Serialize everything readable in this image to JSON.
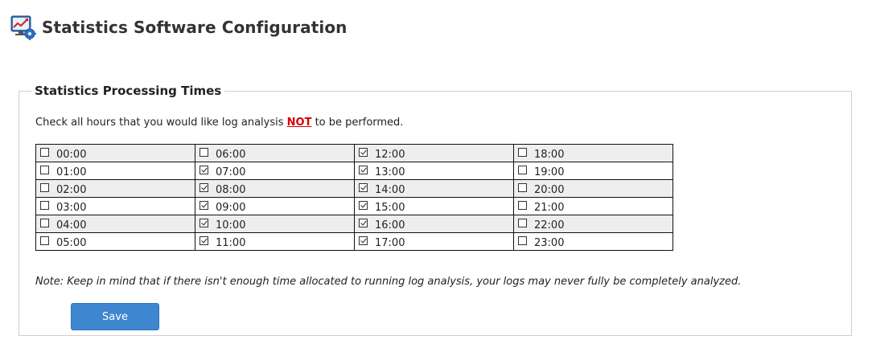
{
  "header": {
    "title": "Statistics Software Configuration",
    "icon": "statistics-monitor-gear-icon"
  },
  "section": {
    "legend": "Statistics Processing Times",
    "instruction_prefix": "Check all hours that you would like log analysis ",
    "instruction_emphasis": "NOT",
    "instruction_suffix": " to be performed.",
    "emphasis_color": "#d40000"
  },
  "hours": [
    [
      {
        "label": "00:00",
        "checked": false
      },
      {
        "label": "06:00",
        "checked": false
      },
      {
        "label": "12:00",
        "checked": true
      },
      {
        "label": "18:00",
        "checked": false
      }
    ],
    [
      {
        "label": "01:00",
        "checked": false
      },
      {
        "label": "07:00",
        "checked": true
      },
      {
        "label": "13:00",
        "checked": true
      },
      {
        "label": "19:00",
        "checked": false
      }
    ],
    [
      {
        "label": "02:00",
        "checked": false
      },
      {
        "label": "08:00",
        "checked": true
      },
      {
        "label": "14:00",
        "checked": true
      },
      {
        "label": "20:00",
        "checked": false
      }
    ],
    [
      {
        "label": "03:00",
        "checked": false
      },
      {
        "label": "09:00",
        "checked": true
      },
      {
        "label": "15:00",
        "checked": true
      },
      {
        "label": "21:00",
        "checked": false
      }
    ],
    [
      {
        "label": "04:00",
        "checked": false
      },
      {
        "label": "10:00",
        "checked": true
      },
      {
        "label": "16:00",
        "checked": true
      },
      {
        "label": "22:00",
        "checked": false
      }
    ],
    [
      {
        "label": "05:00",
        "checked": false
      },
      {
        "label": "11:00",
        "checked": true
      },
      {
        "label": "17:00",
        "checked": true
      },
      {
        "label": "23:00",
        "checked": false
      }
    ]
  ],
  "note": "Note: Keep in mind that if there isn't enough time allocated to running log analysis, your logs may never fully be completely analyzed.",
  "save_button": {
    "label": "Save",
    "color": "#3e87d0"
  }
}
